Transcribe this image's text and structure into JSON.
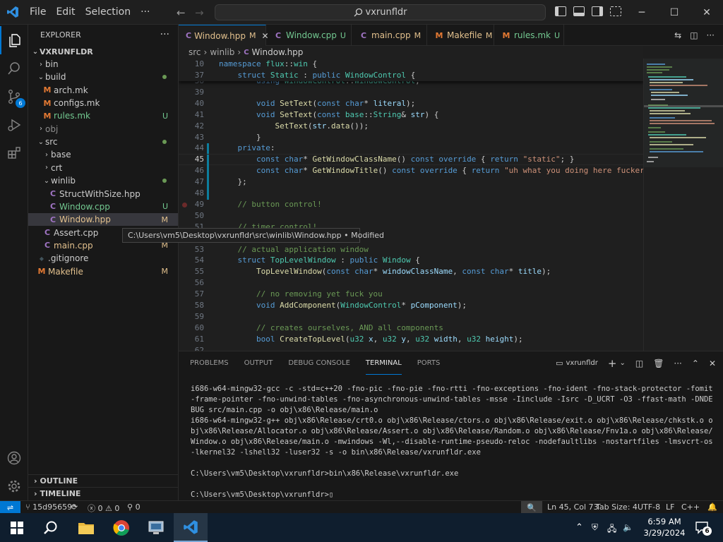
{
  "menu": [
    "File",
    "Edit",
    "Selection",
    "···"
  ],
  "search": {
    "text": "vxrunfldr"
  },
  "sidebar": {
    "title": "EXPLORER",
    "root": "VXRUNFLDR",
    "items": [
      {
        "label": "bin",
        "indent": 1,
        "type": "folder",
        "open": false,
        "status": "",
        "dim": false
      },
      {
        "label": "build",
        "indent": 1,
        "type": "folder",
        "open": true,
        "status": "dot",
        "dim": false
      },
      {
        "label": "arch.mk",
        "indent": 2,
        "type": "mk",
        "status": "",
        "dim": false
      },
      {
        "label": "configs.mk",
        "indent": 2,
        "type": "mk",
        "status": "",
        "dim": false
      },
      {
        "label": "rules.mk",
        "indent": 2,
        "type": "mk",
        "status": "U",
        "dim": false
      },
      {
        "label": "obj",
        "indent": 1,
        "type": "folder",
        "open": false,
        "status": "",
        "dim": true
      },
      {
        "label": "src",
        "indent": 1,
        "type": "folder",
        "open": true,
        "status": "dot",
        "dim": false
      },
      {
        "label": "base",
        "indent": 2,
        "type": "folder",
        "open": false,
        "status": "",
        "dim": false
      },
      {
        "label": "crt",
        "indent": 2,
        "type": "folder",
        "open": false,
        "status": "",
        "dim": false
      },
      {
        "label": "winlib",
        "indent": 2,
        "type": "folder",
        "open": true,
        "status": "dot",
        "dim": false
      },
      {
        "label": "StructWithSize.hpp",
        "indent": 3,
        "type": "cpp",
        "status": "",
        "dim": false
      },
      {
        "label": "Window.cpp",
        "indent": 3,
        "type": "cpp",
        "status": "U",
        "dim": false
      },
      {
        "label": "Window.hpp",
        "indent": 3,
        "type": "cpp",
        "status": "M",
        "dim": false,
        "selected": true
      },
      {
        "label": "Assert.cpp",
        "indent": 2,
        "type": "cpp",
        "status": "",
        "dim": false
      },
      {
        "label": "main.cpp",
        "indent": 2,
        "type": "cpp",
        "status": "M",
        "dim": false
      },
      {
        "label": ".gitignore",
        "indent": 1,
        "type": "git",
        "status": "",
        "dim": false
      },
      {
        "label": "Makefile",
        "indent": 1,
        "type": "mk",
        "status": "M",
        "dim": false
      }
    ],
    "outline": "OUTLINE",
    "timeline": "TIMELINE"
  },
  "tooltip": "C:\\Users\\vm5\\Desktop\\vxrunfldr\\src\\winlib\\Window.hpp • Modified",
  "tabs": [
    {
      "label": "Window.hpp",
      "badge": "M",
      "icon": "C",
      "active": true
    },
    {
      "label": "Window.cpp",
      "badge": "U",
      "icon": "C",
      "active": false
    },
    {
      "label": "main.cpp",
      "badge": "M",
      "icon": "C",
      "active": false
    },
    {
      "label": "Makefile",
      "badge": "M",
      "icon": "M",
      "active": false
    },
    {
      "label": "rules.mk",
      "badge": "U",
      "icon": "M",
      "active": false
    }
  ],
  "breadcrumb": [
    "src",
    "winlib",
    "Window.hpp"
  ],
  "editor": {
    "current_line": "45",
    "lines": [
      {
        "n": "38",
        "html": "        <span class='kw'>using</span> <span class='ty'>WindowControl</span>::<span class='ty'>WindowControl</span>;"
      },
      {
        "n": "39",
        "html": ""
      },
      {
        "n": "40",
        "html": "        <span class='kw'>void</span> <span class='fn'>SetText</span>(<span class='kw'>const</span> <span class='kw'>char</span>* <span class='vr'>literal</span>);"
      },
      {
        "n": "41",
        "html": "        <span class='kw'>void</span> <span class='fn'>SetText</span>(<span class='kw'>const</span> <span class='ns'>base</span>::<span class='ty'>String</span>&amp; <span class='vr'>str</span>) {"
      },
      {
        "n": "42",
        "html": "            <span class='fn'>SetText</span>(<span class='vr'>str</span>.<span class='fn'>data</span>());"
      },
      {
        "n": "43",
        "html": "        }"
      },
      {
        "n": "44",
        "html": "    <span class='kw'>private</span>:"
      },
      {
        "n": "45",
        "html": "        <span class='kw'>const</span> <span class='kw'>char</span>* <span class='fn'>GetWindowClassName</span>() <span class='kw'>const</span> <span class='kw'>override</span> { <span class='kw'>return</span> <span class='st'>\"static\"</span>; }"
      },
      {
        "n": "46",
        "html": "        <span class='kw'>const</span> <span class='kw'>char</span>* <span class='fn'>GetWindowTitle</span>() <span class='kw'>const</span> <span class='kw'>override</span> { <span class='kw'>return</span> <span class='st'>\"uh what you doing here fucker g</span>"
      },
      {
        "n": "47",
        "html": "    };"
      },
      {
        "n": "48",
        "html": ""
      },
      {
        "n": "49",
        "html": "    <span class='cm'>// button control!</span>"
      },
      {
        "n": "50",
        "html": ""
      },
      {
        "n": "51",
        "html": "    <span class='cm'>// timer control!</span>"
      },
      {
        "n": "52",
        "html": ""
      },
      {
        "n": "53",
        "html": "    <span class='cm'>// actual application window</span>"
      },
      {
        "n": "54",
        "html": "    <span class='kw'>struct</span> <span class='ty'>TopLevelWindow</span> : <span class='kw'>public</span> <span class='ty'>Window</span> {"
      },
      {
        "n": "55",
        "html": "        <span class='fn'>TopLevelWindow</span>(<span class='kw'>const</span> <span class='kw'>char</span>* <span class='vr'>windowClassName</span>, <span class='kw'>const</span> <span class='kw'>char</span>* <span class='vr'>title</span>);"
      },
      {
        "n": "56",
        "html": ""
      },
      {
        "n": "57",
        "html": "        <span class='cm'>// no removing yet fuck you</span>"
      },
      {
        "n": "58",
        "html": "        <span class='kw'>void</span> <span class='fn'>AddComponent</span>(<span class='ty'>WindowControl</span>* <span class='vr'>pComponent</span>);"
      },
      {
        "n": "59",
        "html": ""
      },
      {
        "n": "60",
        "html": "        <span class='cm'>// creates ourselves, AND all components</span>"
      },
      {
        "n": "61",
        "html": "        <span class='kw'>bool</span> <span class='fn'>CreateTopLevel</span>(<span class='ty'>u32</span> <span class='vr'>x</span>, <span class='ty'>u32</span> <span class='vr'>y</span>, <span class='ty'>u32</span> <span class='vr'>width</span>, <span class='ty'>u32</span> <span class='vr'>height</span>);"
      },
      {
        "n": "62",
        "html": ""
      }
    ],
    "sticky": [
      {
        "n": "10",
        "html": "<span class='kw'>namespace</span> <span class='ns'>flux</span>::<span class='ns'>win</span> {"
      },
      {
        "n": "37",
        "html": "    <span class='kw'>struct</span> <span class='ty'>Static</span> : <span class='kw'>public</span> <span class='ty'>WindowControl</span> {"
      }
    ]
  },
  "panel": {
    "tabs": [
      "PROBLEMS",
      "OUTPUT",
      "DEBUG CONSOLE",
      "TERMINAL",
      "PORTS"
    ],
    "active_tab": "TERMINAL",
    "terminal_name": "vxrunfldr",
    "lines": [
      "i686-w64-mingw32-gcc -c -std=c++20 -fno-pic -fno-pie -fno-rtti -fno-exceptions -fno-ident -fno-stack-protector -fomit-frame-pointer -fno-unwind-tables -fno-asynchronous-unwind-tables -msse -Iinclude -Isrc -D_UCRT -O3 -ffast-math -DNDEBUG src/main.cpp -o obj\\x86\\Release/main.o",
      "i686-w64-mingw32-g++ obj\\x86\\Release/crt0.o obj\\x86\\Release/ctors.o obj\\x86\\Release/exit.o obj\\x86\\Release/chkstk.o obj\\x86\\Release/Allocator.o obj\\x86\\Release/Assert.o obj\\x86\\Release/Random.o obj\\x86\\Release/Fnv1a.o obj\\x86\\Release/Window.o obj\\x86\\Release/main.o -mwindows -Wl,--disable-runtime-pseudo-reloc -nodefaultlibs -nostartfiles -lmsvcrt-os -lkernel32 -lshell32 -luser32 -s -o bin\\x86\\Release/vxrunfldr.exe",
      "",
      "C:\\Users\\vm5\\Desktop\\vxrunfldr>bin\\x86\\Release\\vxrunfldr.exe",
      "",
      "C:\\Users\\vm5\\Desktop\\vxrunfldr>"
    ]
  },
  "status": {
    "branch": "15d95659*",
    "errors": "0",
    "warnings": "0",
    "ports": "0",
    "position": "Ln 45, Col 73",
    "tabsize": "Tab Size: 4",
    "encoding": "UTF-8",
    "eol": "LF",
    "language": "C++"
  },
  "taskbar": {
    "time": "6:59 AM",
    "date": "3/29/2024",
    "notifications": "6"
  },
  "colors": {
    "accent": "#0078d4",
    "modified": "#e2c08d",
    "untracked": "#73c991"
  }
}
